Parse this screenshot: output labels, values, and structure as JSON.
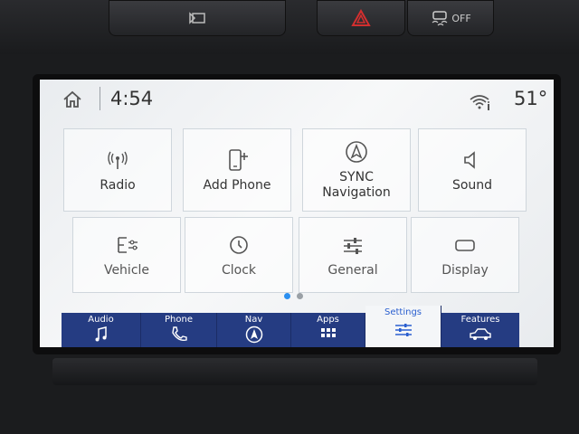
{
  "status_bar": {
    "time": "4:54",
    "temperature": "51°",
    "icons": [
      "home-icon",
      "wifi-info-icon"
    ]
  },
  "hardware_buttons": {
    "traction_label": "OFF",
    "icons": [
      "media-icon",
      "hazard-icon",
      "traction-control-icon"
    ]
  },
  "tiles": [
    {
      "label": "Radio",
      "icon": "radio-antenna-icon"
    },
    {
      "label": "Add Phone",
      "icon": "add-phone-icon"
    },
    {
      "label": "SYNC Navigation",
      "icon": "navigation-arrow-icon"
    },
    {
      "label": "Sound",
      "icon": "speaker-icon"
    },
    {
      "label": "Vehicle",
      "icon": "vehicle-settings-icon"
    },
    {
      "label": "Clock",
      "icon": "clock-icon"
    },
    {
      "label": "General",
      "icon": "sliders-icon"
    },
    {
      "label": "Display",
      "icon": "display-icon"
    }
  ],
  "pager": {
    "pages": 2,
    "current": 1
  },
  "bottom_nav": [
    {
      "label": "Audio",
      "icon": "music-note-icon"
    },
    {
      "label": "Phone",
      "icon": "phone-icon"
    },
    {
      "label": "Nav",
      "icon": "nav-arrow-icon"
    },
    {
      "label": "Apps",
      "icon": "apps-grid-icon"
    },
    {
      "label": "Settings",
      "icon": "settings-sliders-icon",
      "active": true
    },
    {
      "label": "Features",
      "icon": "car-icon"
    }
  ],
  "colors": {
    "nav_bar": "#253c82",
    "active_tab_text": "#2a5fcf",
    "hazard": "#d32f2f",
    "pager_active": "#2a8ff0",
    "pager_inactive": "#9aa0a6"
  }
}
